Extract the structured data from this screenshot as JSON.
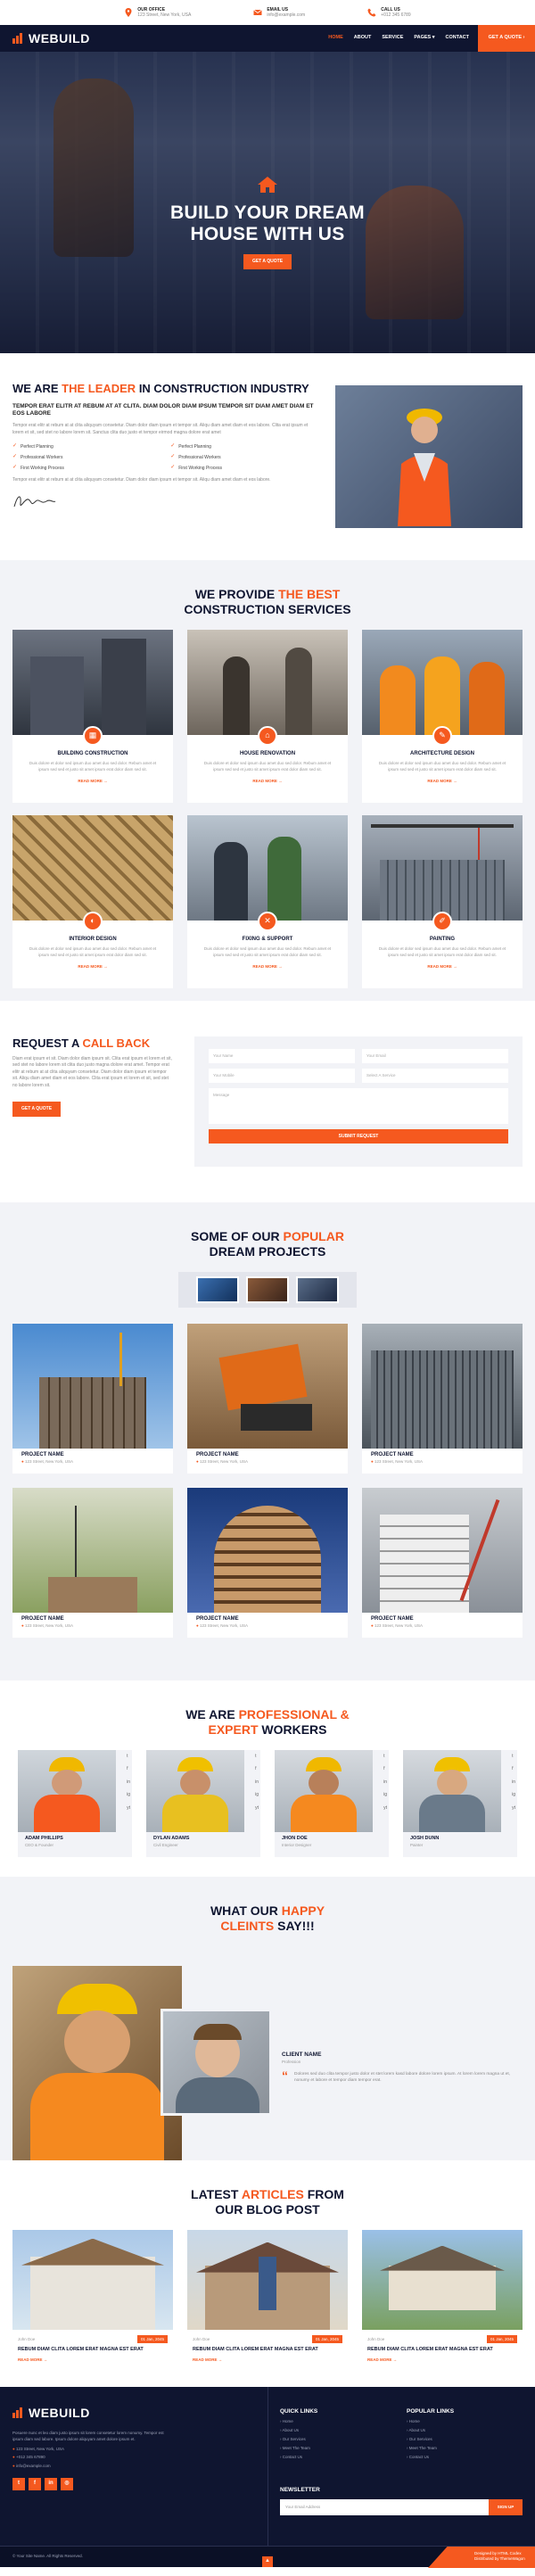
{
  "topbar": {
    "items": [
      {
        "icon": "map-pin-icon",
        "title": "OUR OFFICE",
        "text": "123 Street, New York, USA"
      },
      {
        "icon": "mail-icon",
        "title": "EMAIL US",
        "text": "info@example.com"
      },
      {
        "icon": "phone-icon",
        "title": "CALL US",
        "text": "+012 345 6789"
      }
    ]
  },
  "nav": {
    "logo": "WEBUILD",
    "menu": [
      "HOME",
      "ABOUT",
      "SERVICE",
      "PAGES ▾",
      "CONTACT"
    ],
    "cta": "GET A QUOTE ›"
  },
  "hero": {
    "line1": "BUILD YOUR DREAM",
    "line2": "HOUSE WITH US",
    "button": "GET A QUOTE"
  },
  "about": {
    "title_a": "WE ARE ",
    "title_b": "THE LEADER",
    "title_c": " IN CONSTRUCTION INDUSTRY",
    "subtitle": "TEMPOR ERAT ELITR AT REBUM AT AT CLITA. DIAM DOLOR DIAM IPSUM TEMPOR SIT DIAM AMET DIAM ET EOS LABORE",
    "para1": "Tempor erat elitr at rebum at at clita aliquyam consetetur. Diam dolor diam ipsum et tempor sit. Aliqu diam amet diam et eos labore. Clita erat ipsum et lorem et sit, sed stet no labore lorem sit. Sanctus clita duo justo et tempor eirmod magna dolore erat amet",
    "checks": [
      "Perfect Planning",
      "Perfect Planning",
      "Professional Workers",
      "Professional Workers",
      "First Working Process",
      "First Working Process"
    ],
    "para2": "Tempor erat elitr at rebum at at clita aliquyam consetetur. Diam dolor diam ipsum et tempor sit. Aliqu diam amet diam et eos labore.",
    "signature": "Signature"
  },
  "services": {
    "title_a": "WE PROVIDE ",
    "title_b": "THE BEST",
    "title_c": "CONSTRUCTION SERVICES",
    "items": [
      {
        "name": "BUILDING CONSTRUCTION",
        "icon": "building-icon"
      },
      {
        "name": "HOUSE RENOVATION",
        "icon": "house-icon"
      },
      {
        "name": "ARCHITECTURE DESIGN",
        "icon": "compass-icon"
      },
      {
        "name": "INTERIOR DESIGN",
        "icon": "paint-icon"
      },
      {
        "name": "FIXING & SUPPORT",
        "icon": "tools-icon"
      },
      {
        "name": "PAINTING",
        "icon": "brush-icon"
      }
    ],
    "desc": "Duis dolore et dolor sed ipsum duo amet duo sed dolor. Rebum amet et ipsum sed sed et justo sit amet ipsum erat dolor diam sed sit.",
    "read_more": "READ MORE →"
  },
  "callback": {
    "title_a": "REQUEST A ",
    "title_b": "CALL BACK",
    "text": "Diam erat ipsum et sit. Diam dolor diam ipsum sit. Clita erat ipsum et lorem et sit, sed stet no labore lorem sit clita duo justo magna dolore erat amet. Tempor erat elitr at rebum at at clita aliquyam consetetur. Diam dolor diam ipsum et tempor sit. Aliqu diam amet diam et eos labore. Clita erat ipsum et lorem et sit, sed stet no labore lorem sit.",
    "button": "GET A QUOTE",
    "f_name": "Your Name",
    "f_email": "Your Email",
    "f_mobile": "Your Mobile",
    "f_service": "Select A Service",
    "f_message": "Message",
    "submit": "SUBMIT REQUEST"
  },
  "projects": {
    "title_a": "SOME OF OUR ",
    "title_b": "POPULAR",
    "title_c": "DREAM PROJECTS",
    "name": "PROJECT NAME",
    "address": "123 Street, New York, USA"
  },
  "workers": {
    "title_a": "WE ARE ",
    "title_b": "PROFESSIONAL &",
    "title_c": "EXPERT",
    "title_d": " WORKERS",
    "list": [
      {
        "name": "ADAM PHILLIPS",
        "role": "CEO & Founder"
      },
      {
        "name": "DYLAN ADAMS",
        "role": "Civil Engineer"
      },
      {
        "name": "JHON DOE",
        "role": "Interior Designer"
      },
      {
        "name": "JOSH DUNN",
        "role": "Painter"
      }
    ],
    "social": [
      "t",
      "f",
      "in",
      "ig",
      "yt"
    ]
  },
  "testimonial": {
    "title_a": "WHAT OUR ",
    "title_b": "HAPPY",
    "title_c": "CLEINTS",
    "title_d": " SAY!!!",
    "client": "CLIENT NAME",
    "role": "Profession",
    "quote": "Dolores sed duo clita tempor justo dolor et stet lorem kasd labore dolore lorem ipsum. At lorem lorem magna ut et, nonumy et labore et tempor diam tempor erat."
  },
  "blog": {
    "title_a": "LATEST ",
    "title_b": "ARTICLES",
    "title_c": " FROM",
    "title_d": "OUR BLOG POST",
    "author": "John Doe",
    "date": "01 Jan, 2045",
    "post_title": "REBUM DIAM CLITA LOREM ERAT MAGNA EST ERAT",
    "read_more": "READ MORE →"
  },
  "footer": {
    "logo": "WEBUILD",
    "text": "Posuere nunc et leo diam justo ipsum sit lorem consetetur lorem nonumy. Tempor est ipsum diam sed labore. Ipsum dolore aliquyam amet dolore ipsum et.",
    "address": "123 Street, New York, USA",
    "phone": "+012 345 67890",
    "email": "info@example.com",
    "quick_h": "QUICK LINKS",
    "quick": [
      "› Home",
      "› About Us",
      "› Our Services",
      "› Meet The Team",
      "› Contact Us"
    ],
    "popular_h": "POPULAR LINKS",
    "popular": [
      "› Home",
      "› About Us",
      "› Our Services",
      "› Meet The Team",
      "› Contact Us"
    ],
    "news_h": "NEWSLETTER",
    "news_ph": "Your Email Address",
    "sign_up": "SIGN UP",
    "copyright": "© Your Site Name. All Rights Reserved.",
    "designed": "Designed by HTML Codex",
    "distributed": "Distributed by ThemeWagon"
  },
  "colors": {
    "accent": "#f5591f",
    "navy": "#0f1530"
  }
}
